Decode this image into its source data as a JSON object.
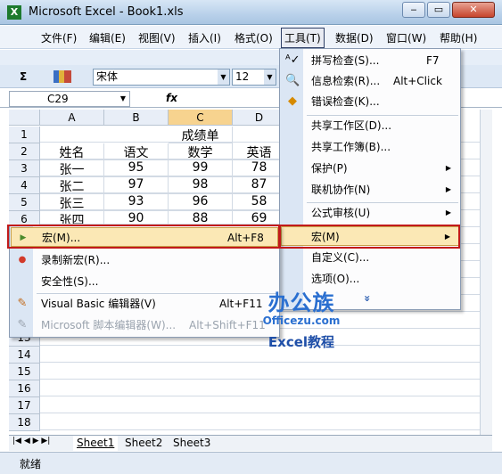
{
  "window": {
    "title": "Microsoft Excel - Book1.xls",
    "app_icon": "excel-icon"
  },
  "menubar": {
    "items": [
      "文件(F)",
      "编辑(E)",
      "视图(V)",
      "插入(I)",
      "格式(O)",
      "工具(T)",
      "数据(D)",
      "窗口(W)",
      "帮助(H)"
    ],
    "active": "工具(T)"
  },
  "toolbar": {
    "sigma": "Σ",
    "font": "宋体",
    "size": "12"
  },
  "formula": {
    "namebox": "C29",
    "fx": "fx"
  },
  "grid": {
    "columns": [
      "A",
      "B",
      "C",
      "D"
    ],
    "selected_column": "C",
    "rows": [
      "1",
      "2",
      "3",
      "4",
      "5",
      "6",
      "7",
      "8",
      "9",
      "10",
      "11",
      "12",
      "13",
      "14",
      "15",
      "16",
      "17",
      "18",
      "19"
    ],
    "cells": {
      "c1": "成绩单",
      "a2": "姓名",
      "b2": "语文",
      "c2": "数学",
      "d2": "英语",
      "a3": "张一",
      "b3": "95",
      "c3": "99",
      "d3": "78",
      "a4": "张二",
      "b4": "97",
      "c4": "98",
      "d4": "87",
      "a5": "张三",
      "b5": "93",
      "c5": "96",
      "d5": "58",
      "a6": "张四",
      "b6": "90",
      "c6": "88",
      "d6": "69"
    }
  },
  "tools_menu": {
    "items": [
      {
        "label": "拼写检查(S)...",
        "shortcut": "F7"
      },
      {
        "label": "信息检索(R)...",
        "shortcut": "Alt+Click"
      },
      {
        "label": "错误检查(K)..."
      },
      {
        "label": "共享工作区(D)..."
      },
      {
        "label": "共享工作簿(B)..."
      },
      {
        "label": "保护(P)"
      },
      {
        "label": "联机协作(N)"
      },
      {
        "label": "公式审核(U)"
      },
      {
        "label": "宏(M)"
      },
      {
        "label": "自定义(C)..."
      },
      {
        "label": "选项(O)..."
      }
    ],
    "expand": "»"
  },
  "macro_submenu": {
    "items": [
      {
        "label": "宏(M)...",
        "shortcut": "Alt+F8"
      },
      {
        "label": "录制新宏(R)..."
      },
      {
        "label": "安全性(S)..."
      },
      {
        "label": "Visual Basic 编辑器(V)",
        "shortcut": "Alt+F11"
      },
      {
        "label": "Microsoft 脚本编辑器(W)...",
        "shortcut": "Alt+Shift+F11"
      }
    ]
  },
  "sheets": {
    "tabs": [
      "Sheet1",
      "Sheet2",
      "Sheet3"
    ],
    "active": "Sheet1"
  },
  "status": {
    "text": "就绪"
  },
  "watermark": {
    "logo": "办公族",
    "url": "Officezu.com",
    "tagline": "Excel教程"
  },
  "colors": {
    "highlight_border": "#c21a1a",
    "menu_hover": "#fbe8b5",
    "selected_col": "#f7d38f"
  }
}
